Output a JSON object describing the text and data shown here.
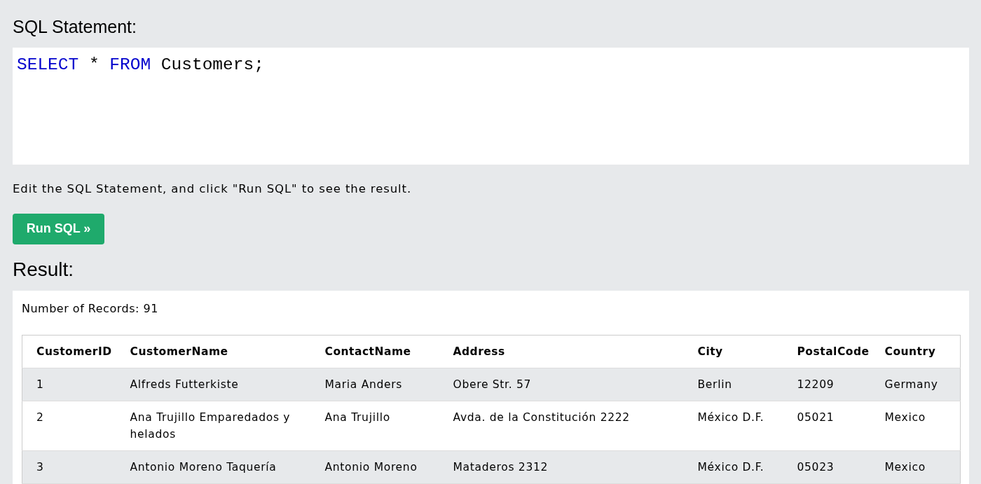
{
  "sql_statement": {
    "heading": "SQL Statement:",
    "code": [
      {
        "text": "SELECT",
        "kind": "keyword"
      },
      {
        "text": "*",
        "kind": "plain"
      },
      {
        "text": "FROM",
        "kind": "keyword"
      },
      {
        "text": "Customers;",
        "kind": "plain"
      }
    ]
  },
  "instructions": "Edit the SQL Statement, and click \"Run SQL\" to see the result.",
  "run_button": {
    "label": "Run SQL »"
  },
  "result": {
    "heading": "Result:",
    "record_count": "Number of Records: 91",
    "table": {
      "columns": [
        "CustomerID",
        "CustomerName",
        "ContactName",
        "Address",
        "City",
        "PostalCode",
        "Country"
      ],
      "rows": [
        [
          "1",
          "Alfreds Futterkiste",
          "Maria Anders",
          "Obere Str. 57",
          "Berlin",
          "12209",
          "Germany"
        ],
        [
          "2",
          "Ana Trujillo Emparedados y helados",
          "Ana Trujillo",
          "Avda. de la Constitución 2222",
          "México D.F.",
          "05021",
          "Mexico"
        ],
        [
          "3",
          "Antonio Moreno Taquería",
          "Antonio Moreno",
          "Mataderos 2312",
          "México D.F.",
          "05023",
          "Mexico"
        ]
      ]
    }
  }
}
